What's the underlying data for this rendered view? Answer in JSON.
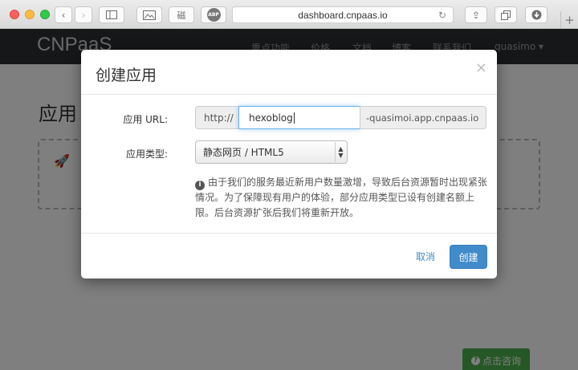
{
  "browser": {
    "address": "dashboard.cnpaas.io",
    "abp_label": "ABP",
    "ext_glyph": "磁"
  },
  "site": {
    "brand": "CNPaaS",
    "nav": [
      "重点功能",
      "价格",
      "文档",
      "博客",
      "联系我们"
    ],
    "user": "quasimo ▾",
    "page_title": "应用",
    "help_button": "点击咨询"
  },
  "modal": {
    "title": "创建应用",
    "close": "×",
    "url_label": "应用 URL:",
    "url_prefix": "http://",
    "url_value": "hexoblog",
    "url_suffix": "-quasimoi.app.cnpaas.io",
    "type_label": "应用类型:",
    "type_selected": "静态网页 / HTML5",
    "notice": "由于我们的服务最近新用户数量激增，导致后台资源暂时出现紧张情况。为了保障现有用户的体验，部分应用类型已设有创建名额上限。后台资源扩张后我们将重新开放。",
    "cancel": "取消",
    "create": "创建"
  }
}
